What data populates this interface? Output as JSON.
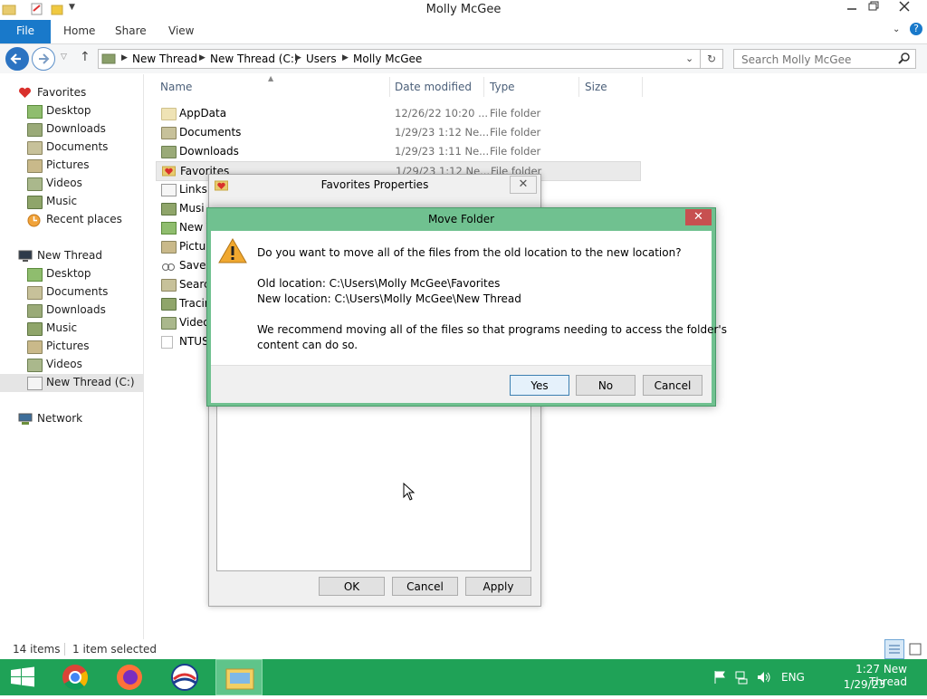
{
  "window": {
    "title": "Molly McGee"
  },
  "ribbon": {
    "file": "File",
    "tabs": [
      "Home",
      "Share",
      "View"
    ]
  },
  "address": {
    "crumbs": [
      "New Thread",
      "New Thread (C:)",
      "Users",
      "Molly McGee"
    ]
  },
  "search": {
    "placeholder": "Search Molly McGee"
  },
  "nav": {
    "favorites": "Favorites",
    "favorites_items": [
      "Desktop",
      "Downloads",
      "Documents",
      "Pictures",
      "Videos",
      "Music",
      "Recent places"
    ],
    "computer": "New Thread",
    "computer_items": [
      "Desktop",
      "Documents",
      "Downloads",
      "Music",
      "Pictures",
      "Videos",
      "New Thread (C:)"
    ],
    "network": "Network"
  },
  "columns": {
    "name": "Name",
    "date": "Date modified",
    "type": "Type",
    "size": "Size"
  },
  "files": [
    {
      "name": "AppData",
      "date": "12/26/22 10:20 ...",
      "type": "File folder"
    },
    {
      "name": "Documents",
      "date": "1/29/23 1:12 Ne...",
      "type": "File folder"
    },
    {
      "name": "Downloads",
      "date": "1/29/23 1:11 Ne...",
      "type": "File folder"
    },
    {
      "name": "Favorites",
      "date": "1/29/23 1:12 Ne...",
      "type": "File folder"
    },
    {
      "name": "Links",
      "date": "",
      "type": ""
    },
    {
      "name": "Musi",
      "date": "",
      "type": ""
    },
    {
      "name": "New T",
      "date": "",
      "type": ""
    },
    {
      "name": "Pictur",
      "date": "",
      "type": ""
    },
    {
      "name": "Saved",
      "date": "",
      "type": ""
    },
    {
      "name": "Searc",
      "date": "",
      "type": ""
    },
    {
      "name": "Tracin",
      "date": "",
      "type": ""
    },
    {
      "name": "Video",
      "date": "",
      "type": ""
    },
    {
      "name": "NTUSI",
      "date": "",
      "type": ""
    }
  ],
  "status": {
    "count": "14 items",
    "selected": "1 item selected"
  },
  "props_dialog": {
    "title": "Favorites Properties",
    "ok": "OK",
    "cancel": "Cancel",
    "apply": "Apply"
  },
  "move_dialog": {
    "title": "Move Folder",
    "question": "Do you want to move all of the files from the old location to the new location?",
    "old_location": "Old location: C:\\Users\\Molly McGee\\Favorites",
    "new_location": "New location: C:\\Users\\Molly McGee\\New Thread",
    "recommend_line1": "We recommend moving all of the files so that programs needing to access the folder's",
    "recommend_line2": "content can do so.",
    "yes": "Yes",
    "no": "No",
    "cancel": "Cancel"
  },
  "tray": {
    "lang": "ENG",
    "time": "1:27 New Thread",
    "date": "1/29/23"
  },
  "colors": {
    "taskbar": "#1fa257",
    "dialog_frame": "#70c190",
    "ribbon_file": "#1979ca",
    "close_red": "#c75050"
  }
}
